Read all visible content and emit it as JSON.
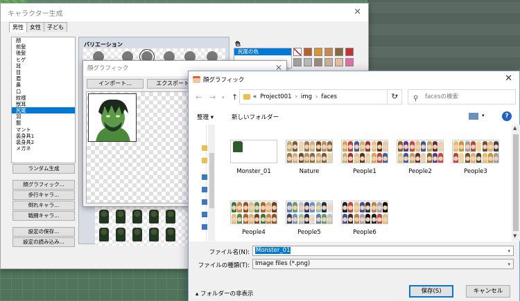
{
  "gen_window": {
    "title": "キャラクター生成",
    "tabs": [
      "男性",
      "女性",
      "子ども"
    ],
    "parts": [
      "顔",
      "前髪",
      "後髪",
      "ヒゲ",
      "耳",
      "目",
      "眉",
      "鼻",
      "口",
      "紋様",
      "獣耳",
      "尻尾",
      "羽",
      "服",
      "マント",
      "装身具1",
      "装身具2",
      "メガネ"
    ],
    "selected_part_index": 11,
    "random_button": "ランダム生成",
    "face_graphic_button": "顔グラフィック...",
    "walk_button": "歩行キャラ...",
    "down_button": "倒れキャラ...",
    "battle_button": "戦闘キャラ...",
    "save_settings_button": "設定の保存...",
    "load_settings_button": "設定の読み込み...",
    "variation_label": "バリエーション",
    "color_label": "色",
    "color_items": [
      "尻尾の色"
    ],
    "swatch_colors": [
      "#ffffff",
      "#b5612c",
      "#d89630",
      "#c98a45",
      "#8a6a3a",
      "#c43434",
      "#a0a0a0",
      "#b8b8b8",
      "#9a8a7a",
      "#c8b090",
      "#e0c0a0",
      "#e070a0"
    ]
  },
  "face_dialog": {
    "title": "顔グラフィック",
    "import_button": "インポート...",
    "export_button": "エクスポート..."
  },
  "file_dialog": {
    "title": "顔グラフィック",
    "path": [
      "Project001",
      "img",
      "faces"
    ],
    "path_prefix": "«",
    "search_placeholder": "facesの検索",
    "organize_label": "整理 ▾",
    "new_folder_label": "新しいフォルダー",
    "files": [
      {
        "name": "Monster_01",
        "palette": [
          "#2f5a2a"
        ]
      },
      {
        "name": "Nature",
        "palette": [
          "#c9a66b",
          "#7a5a3a",
          "#e8d8b0",
          "#9a7a50",
          "#d0b080",
          "#6a4a2a",
          "#b89060",
          "#8a6a40"
        ]
      },
      {
        "name": "People1",
        "palette": [
          "#e0a050",
          "#c04040",
          "#4060a0",
          "#d0b070",
          "#a03030",
          "#e8c080",
          "#603020",
          "#e0d0a0"
        ]
      },
      {
        "name": "People2",
        "palette": [
          "#8a5a2a",
          "#5a3a8a",
          "#d04040",
          "#e0c080",
          "#3a5aa0",
          "#c0a060",
          "#702a2a",
          "#e8d0b0"
        ]
      },
      {
        "name": "People3",
        "palette": [
          "#e0c060",
          "#d09040",
          "#a0a0a0",
          "#c04040",
          "#f0d890",
          "#705030",
          "#e0b070",
          "#404040"
        ]
      },
      {
        "name": "People4",
        "palette": [
          "#3a7a3a",
          "#d08040",
          "#905030",
          "#e0c080",
          "#4a8a4a",
          "#b06030",
          "#e8b070",
          "#704020"
        ]
      },
      {
        "name": "People5",
        "palette": [
          "#5080c0",
          "#60a060",
          "#c0c0d0",
          "#304070",
          "#7090d0",
          "#a0c0a0",
          "#203050",
          "#e0e0e0"
        ]
      },
      {
        "name": "People6",
        "palette": [
          "#202020",
          "#d04040",
          "#e0c080",
          "#4050a0",
          "#303030",
          "#c08040",
          "#a0a0c0",
          "#101010"
        ]
      }
    ],
    "filename_label": "ファイル名(N):",
    "filename_value": "Monster_01",
    "filetype_label": "ファイルの種類(T):",
    "filetype_value": "Image files (*.png)",
    "hide_folders_label": "フォルダーの非表示",
    "save_button": "保存(S)",
    "cancel_button": "キャンセル"
  }
}
